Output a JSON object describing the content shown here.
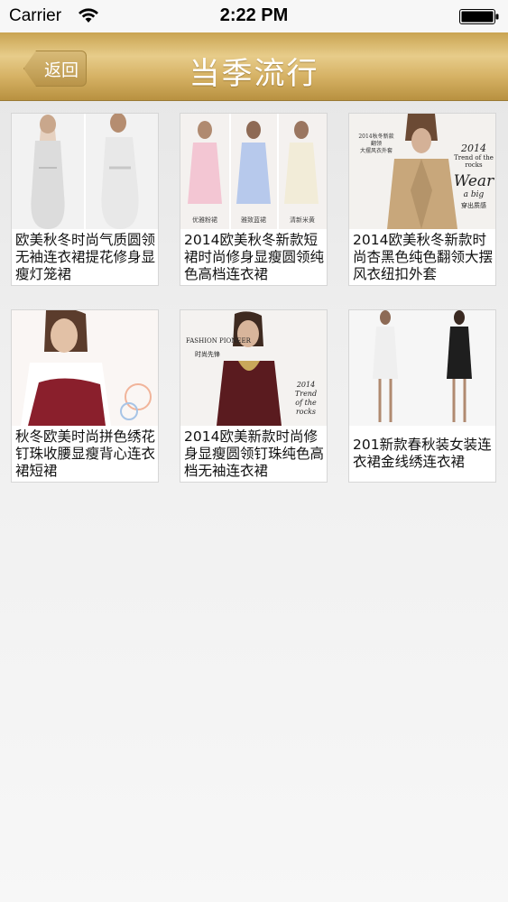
{
  "status_bar": {
    "carrier": "Carrier",
    "time": "2:22 PM",
    "wifi_icon": "wifi-icon",
    "battery_icon": "battery-full-icon"
  },
  "nav": {
    "back_label": "返回",
    "title": "当季流行",
    "accent_color": "#d6b265"
  },
  "products": [
    {
      "title": "欧美秋冬时尚气质圆领无袖连衣裙提花修身显瘦灯笼裙",
      "image": "two white sleeveless dresses"
    },
    {
      "title": "2014欧美秋冬新款短裙时尚修身显瘦圆领纯色高档连衣裙",
      "image": "three models in pink, blue and cream dresses",
      "image_labels": [
        "优雅粉裙",
        "雅致蓝裙",
        "清新米黄"
      ]
    },
    {
      "title": "2014欧美秋冬新款时尚杏黑色纯色翻领大摆风衣纽扣外套",
      "image": "model in beige trench coat",
      "image_labels": [
        "2014秋冬新款",
        "翻领",
        "大摆风衣外套",
        "2014",
        "Trend of the rocks",
        "Wear",
        "a big",
        "穿出质感"
      ]
    },
    {
      "title": "秋冬欧美时尚拼色绣花钉珠收腰显瘦背心连衣裙短裙",
      "image": "model in red and white sleeveless dress"
    },
    {
      "title": "2014欧美新款时尚修身显瘦圆领钉珠纯色高档无袖连衣裙",
      "image": "model in burgundy sleeveless dress",
      "image_labels": [
        "FASHION PIONEER",
        "时尚先锋",
        "2014",
        "Trend",
        "of the rocks"
      ]
    },
    {
      "title": "201新款春秋装女装连衣裙金线绣连衣裙",
      "image": "two models in white and black embroidered dresses"
    }
  ]
}
